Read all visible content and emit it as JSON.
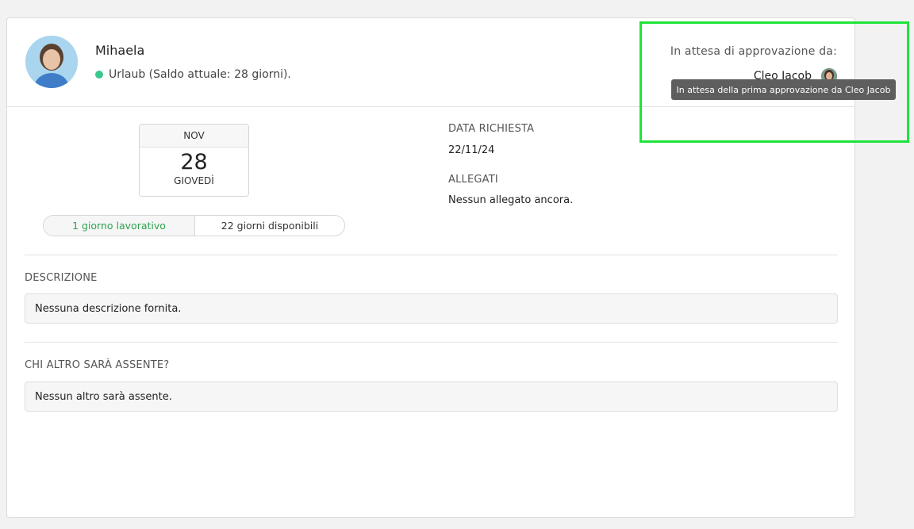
{
  "employee": {
    "name": "Mihaela",
    "status": "Urlaub (Saldo attuale: 28 giorni)."
  },
  "approval": {
    "label": "In attesa di approvazione da:",
    "approver": "Cleo Jacob",
    "tooltip": "In attesa della prima approvazione da Cleo Jacob"
  },
  "calendar": {
    "month": "NOV",
    "day": "28",
    "weekday": "GIOVEDÌ"
  },
  "days": {
    "working": "1 giorno lavorativo",
    "available": "22 giorni disponibili"
  },
  "request": {
    "date_label": "DATA RICHIESTA",
    "date_value": "22/11/24",
    "attachments_label": "ALLEGATI",
    "attachments_value": "Nessun allegato ancora."
  },
  "description": {
    "label": "DESCRIZIONE",
    "value": "Nessuna descrizione fornita."
  },
  "absent": {
    "label": "CHI ALTRO SARÀ ASSENTE?",
    "value": "Nessun altro sarà assente."
  },
  "colors": {
    "status_dot": "#3dc68e",
    "working_days": "#2ea44f",
    "highlight": "#1fe43a",
    "tooltip_bg": "#5e5e5e"
  }
}
